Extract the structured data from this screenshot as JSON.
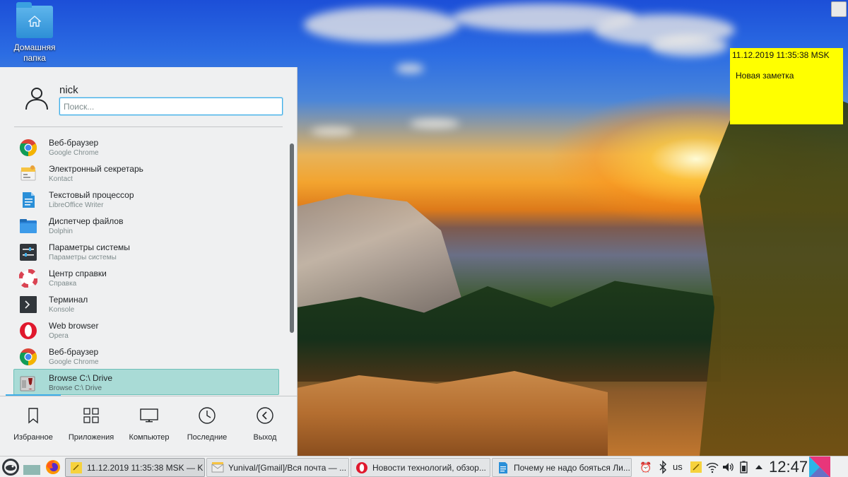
{
  "desktop": {
    "home_folder_label": "Домашняя папка"
  },
  "note": {
    "timestamp": "11.12.2019 11:35:38 MSK",
    "body": "Новая заметка",
    "color": "#ffff00"
  },
  "launcher": {
    "user_name": "nick",
    "search_placeholder": "Поиск...",
    "apps": [
      {
        "title": "Веб-браузер",
        "subtitle": "Google Chrome",
        "icon": "chrome-icon"
      },
      {
        "title": "Электронный секретарь",
        "subtitle": "Kontact",
        "icon": "kontact-icon"
      },
      {
        "title": "Текстовый процессор",
        "subtitle": "LibreOffice Writer",
        "icon": "writer-icon"
      },
      {
        "title": "Диспетчер файлов",
        "subtitle": "Dolphin",
        "icon": "dolphin-icon"
      },
      {
        "title": "Параметры системы",
        "subtitle": "Параметры системы",
        "icon": "settings-icon"
      },
      {
        "title": "Центр справки",
        "subtitle": "Справка",
        "icon": "help-icon"
      },
      {
        "title": "Терминал",
        "subtitle": "Konsole",
        "icon": "terminal-icon"
      },
      {
        "title": "Web browser",
        "subtitle": "Opera",
        "icon": "opera-icon"
      },
      {
        "title": "Веб-браузер",
        "subtitle": "Google Chrome",
        "icon": "chrome-icon"
      },
      {
        "title": "Browse C:\\ Drive",
        "subtitle": "Browse C:\\ Drive",
        "icon": "wine-icon",
        "selected": true
      }
    ],
    "nav": {
      "favorites": "Избранное",
      "applications": "Приложения",
      "computer": "Компьютер",
      "recent": "Последние",
      "leave": "Выход"
    }
  },
  "taskbar": {
    "tasks": [
      {
        "label": "11.12.2019 11:35:38 MSK — K...",
        "icon": "note-icon",
        "active": true
      },
      {
        "label": "Yunival/[Gmail]/Вся почта — ...",
        "icon": "kmail-icon"
      },
      {
        "label": "Новости технологий, обзор...",
        "icon": "opera-icon"
      },
      {
        "label": "Почему не надо бояться Ли...",
        "icon": "writer-icon"
      }
    ],
    "keyboard_layout": "us",
    "clock": "12:47"
  },
  "colors": {
    "accent": "#3daee9",
    "selection": "#a9dbd6",
    "panel": "#eff0f1"
  }
}
